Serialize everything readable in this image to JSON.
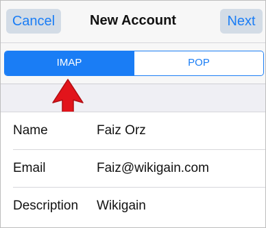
{
  "nav": {
    "cancel_label": "Cancel",
    "title": "New Account",
    "next_label": "Next"
  },
  "account_type": {
    "options": [
      "IMAP",
      "POP"
    ],
    "selected": "IMAP"
  },
  "form": {
    "rows": [
      {
        "label": "Name",
        "value": "Faiz Orz"
      },
      {
        "label": "Email",
        "value": "Faiz@wikigain.com"
      },
      {
        "label": "Description",
        "value": "Wikigain"
      }
    ]
  },
  "colors": {
    "accent": "#1a7df5",
    "arrow": "#e2141b",
    "background": "#efeff4"
  }
}
